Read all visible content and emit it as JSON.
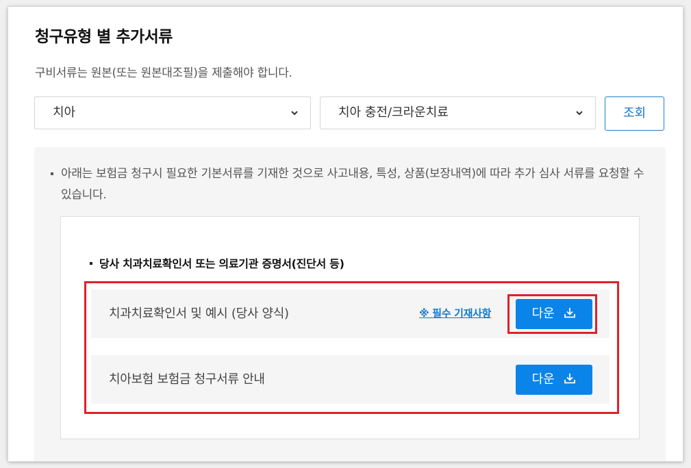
{
  "page": {
    "title": "청구유형 별 추가서류",
    "subtitle": "구비서류는 원본(또는 원본대조필)을 제출해야 합니다."
  },
  "filters": {
    "category_selected": "치아",
    "subcategory_selected": "치아 충전/크라운치료",
    "search_label": "조회"
  },
  "notice": {
    "text": "아래는 보험금 청구시 필요한 기본서류를 기재한 것으로 사고내용, 특성, 상품(보장내역)에 따라 추가 심사 서류를 요청할 수 있습니다."
  },
  "documents": {
    "heading": "당사 치과치료확인서 또는 의료기관 증명서(진단서 등)",
    "items": [
      {
        "label": "치과치료확인서 및 예시 (당사 양식)",
        "link": "※ 필수 기재사항",
        "button": "다운"
      },
      {
        "label": "치아보험 보험금 청구서류 안내",
        "button": "다운"
      }
    ]
  },
  "icons": {
    "select_chevron": "chevron-down-icon",
    "download": "download-icon"
  },
  "colors": {
    "primary_button": "#0a84e8",
    "link": "#0e7ad1",
    "highlight_border": "#e0202a"
  }
}
